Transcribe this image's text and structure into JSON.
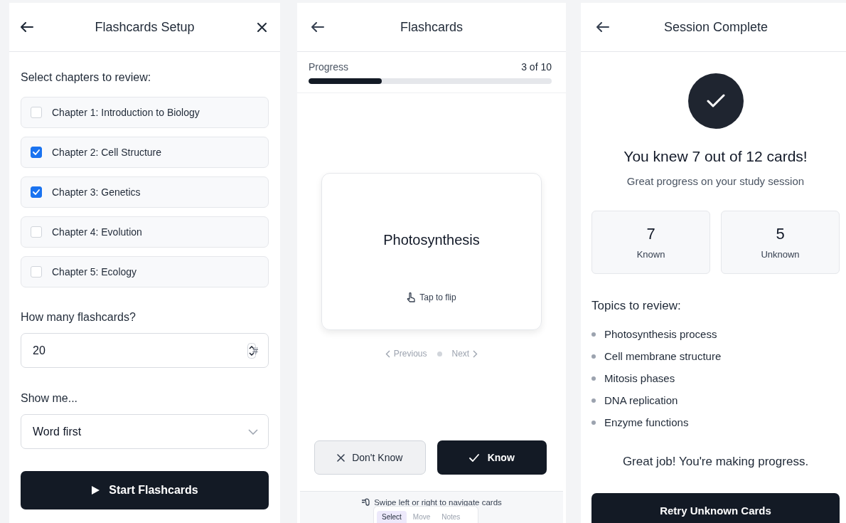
{
  "setup": {
    "title": "Flashcards Setup",
    "chapters_label": "Select chapters to review:",
    "chapters": [
      {
        "label": "Chapter 1: Introduction to Biology",
        "checked": false
      },
      {
        "label": "Chapter 2: Cell Structure",
        "checked": true
      },
      {
        "label": "Chapter 3: Genetics",
        "checked": true
      },
      {
        "label": "Chapter 4: Evolution",
        "checked": false
      },
      {
        "label": "Chapter 5: Ecology",
        "checked": false
      }
    ],
    "count_label": "How many flashcards?",
    "count_value": "20",
    "count_suffix": "#",
    "mode_label": "Show me...",
    "mode_value": "Word first",
    "start_button": "Start Flashcards"
  },
  "flashcards": {
    "title": "Flashcards",
    "progress": {
      "label": "Progress",
      "reading": "3 of 10",
      "level": 0.3
    },
    "card": {
      "term": "Photosynthesis",
      "hint": "Tap to flip"
    },
    "previous": "Previous",
    "next": "Next",
    "dont_know_button": "Don't Know",
    "know_button": "Know",
    "swipe_hint": "Swipe left or right to navigate cards",
    "toolbar": [
      {
        "label": "Select",
        "selected": true
      },
      {
        "label": "Move",
        "selected": false
      },
      {
        "label": "Notes",
        "selected": false
      }
    ]
  },
  "summary": {
    "title": "Session Complete",
    "heading": "You knew 7 out of 12 cards!",
    "subtitle": "Great progress on your study session",
    "stats": [
      {
        "value": "7",
        "label": "Known"
      },
      {
        "value": "5",
        "label": "Unknown"
      }
    ],
    "topics_label": "Topics to review:",
    "topics": [
      "Photosynthesis process",
      "Cell membrane structure",
      "Mitosis phases",
      "DNA replication",
      "Enzyme functions"
    ],
    "message": "Great job! You're making progress.",
    "retry_button": "Retry Unknown Cards"
  }
}
